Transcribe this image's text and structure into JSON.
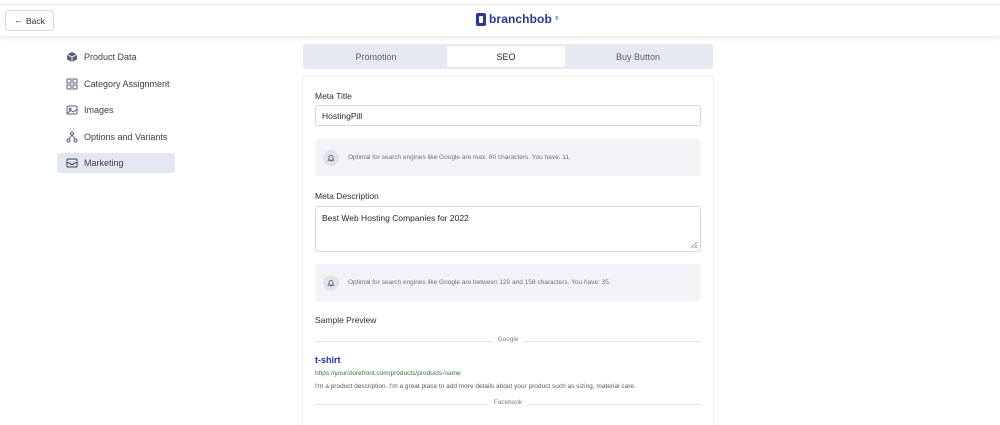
{
  "header": {
    "back_label": "Back",
    "brand_name": "branchbob",
    "brand_mark": "®"
  },
  "sidebar": {
    "items": [
      {
        "label": "Product Data",
        "icon": "box-icon"
      },
      {
        "label": "Category Assignment",
        "icon": "grid-icon"
      },
      {
        "label": "Images",
        "icon": "image-icon"
      },
      {
        "label": "Options and Variants",
        "icon": "variants-icon"
      },
      {
        "label": "Marketing",
        "icon": "inbox-icon",
        "active": true
      }
    ]
  },
  "tabs": [
    {
      "label": "Promotion"
    },
    {
      "label": "SEO",
      "active": true
    },
    {
      "label": "Buy Button"
    }
  ],
  "seo": {
    "meta_title_label": "Meta Title",
    "meta_title_value": "HostingPill",
    "meta_title_hint": "Optimal for search engines like Google are max. 60 characters. You have: 11.",
    "meta_description_label": "Meta Description",
    "meta_description_value": "Best Web Hosting Companies for 2022",
    "meta_description_hint": "Optimal for search engines like Google are between 120 and 158 characters. You have: 35.",
    "sample_preview_label": "Sample Preview",
    "google_label": "Google",
    "google_preview": {
      "title": "t-shirt",
      "url": "https://yourstorefront.com/products/products-name",
      "description": "I'm a product description. I'm a great place to add more details about your product such as sizing, material care."
    },
    "facebook_label": "Facebook"
  },
  "colors": {
    "brand": "#2a3a8c",
    "active_bg": "#e3e7f1",
    "tab_track": "#e6e9f1",
    "google_title": "#2a2ea0",
    "google_url": "#2d7a35"
  }
}
